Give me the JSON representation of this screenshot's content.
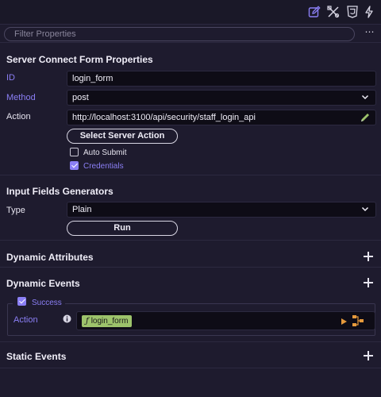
{
  "toolbar": {
    "icons": [
      "edit-icon",
      "tools-icon",
      "css3-icon",
      "lightning-icon"
    ],
    "accent_color": "#8b7ff5"
  },
  "filter": {
    "placeholder": "Filter Properties",
    "more_label": "⋯"
  },
  "form_properties": {
    "title": "Server Connect Form Properties",
    "id_label": "ID",
    "id_value": "login_form",
    "method_label": "Method",
    "method_value": "post",
    "action_label": "Action",
    "action_value": "http://localhost:3100/api/security/staff_login_api",
    "select_server_action_label": "Select Server Action",
    "auto_submit_label": "Auto Submit",
    "auto_submit_checked": false,
    "credentials_label": "Credentials",
    "credentials_checked": true
  },
  "input_generators": {
    "title": "Input Fields Generators",
    "type_label": "Type",
    "type_value": "Plain",
    "run_label": "Run"
  },
  "dynamic_attributes": {
    "title": "Dynamic Attributes"
  },
  "dynamic_events": {
    "title": "Dynamic Events",
    "success_label": "Success",
    "success_checked": true,
    "action_label": "Action",
    "action_chip_prefix": "ƒ",
    "action_chip": "login_form"
  },
  "static_events": {
    "title": "Static Events"
  }
}
